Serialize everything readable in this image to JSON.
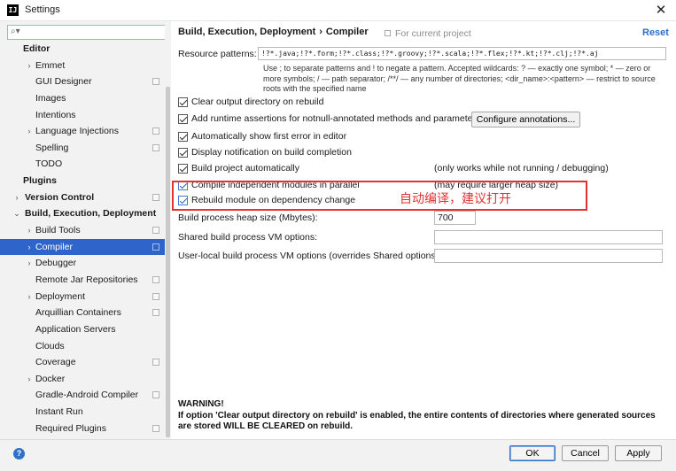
{
  "window": {
    "title": "Settings",
    "icon": "intellij-app-icon"
  },
  "search": {
    "placeholder": "",
    "value": ""
  },
  "sidebar": {
    "items": [
      {
        "label": "Editor",
        "level": 0,
        "bold": true,
        "arrow": "",
        "shared": false
      },
      {
        "label": "Emmet",
        "level": 1,
        "bold": false,
        "arrow": "›",
        "shared": false
      },
      {
        "label": "GUI Designer",
        "level": 1,
        "bold": false,
        "arrow": "",
        "shared": true
      },
      {
        "label": "Images",
        "level": 1,
        "bold": false,
        "arrow": "",
        "shared": false
      },
      {
        "label": "Intentions",
        "level": 1,
        "bold": false,
        "arrow": "",
        "shared": false
      },
      {
        "label": "Language Injections",
        "level": 1,
        "bold": false,
        "arrow": "›",
        "shared": true
      },
      {
        "label": "Spelling",
        "level": 1,
        "bold": false,
        "arrow": "",
        "shared": true
      },
      {
        "label": "TODO",
        "level": 1,
        "bold": false,
        "arrow": "",
        "shared": false
      },
      {
        "label": "Plugins",
        "level": 0,
        "bold": true,
        "arrow": "",
        "shared": false
      },
      {
        "label": "Version Control",
        "level": 0,
        "bold": true,
        "arrow": "›",
        "shared": true
      },
      {
        "label": "Build, Execution, Deployment",
        "level": 0,
        "bold": true,
        "arrow": "⌄",
        "shared": false
      },
      {
        "label": "Build Tools",
        "level": 1,
        "bold": false,
        "arrow": "›",
        "shared": true
      },
      {
        "label": "Compiler",
        "level": 1,
        "bold": false,
        "arrow": "›",
        "shared": true,
        "selected": true
      },
      {
        "label": "Debugger",
        "level": 1,
        "bold": false,
        "arrow": "›",
        "shared": false
      },
      {
        "label": "Remote Jar Repositories",
        "level": 1,
        "bold": false,
        "arrow": "",
        "shared": true
      },
      {
        "label": "Deployment",
        "level": 1,
        "bold": false,
        "arrow": "›",
        "shared": true
      },
      {
        "label": "Arquillian Containers",
        "level": 1,
        "bold": false,
        "arrow": "",
        "shared": true
      },
      {
        "label": "Application Servers",
        "level": 1,
        "bold": false,
        "arrow": "",
        "shared": false
      },
      {
        "label": "Clouds",
        "level": 1,
        "bold": false,
        "arrow": "",
        "shared": false
      },
      {
        "label": "Coverage",
        "level": 1,
        "bold": false,
        "arrow": "",
        "shared": true
      },
      {
        "label": "Docker",
        "level": 1,
        "bold": false,
        "arrow": "›",
        "shared": false
      },
      {
        "label": "Gradle-Android Compiler",
        "level": 1,
        "bold": false,
        "arrow": "",
        "shared": true
      },
      {
        "label": "Instant Run",
        "level": 1,
        "bold": false,
        "arrow": "",
        "shared": false
      },
      {
        "label": "Required Plugins",
        "level": 1,
        "bold": false,
        "arrow": "",
        "shared": true
      }
    ]
  },
  "header": {
    "breadcrumb_parent": "Build, Execution, Deployment",
    "breadcrumb_sep": "›",
    "breadcrumb_current": "Compiler",
    "for_project": "For current project",
    "reset": "Reset"
  },
  "compiler": {
    "resource_label": "Resource patterns:",
    "resource_value": "!?*.java;!?*.form;!?*.class;!?*.groovy;!?*.scala;!?*.flex;!?*.kt;!?*.clj;!?*.aj",
    "resource_hint": "Use ; to separate patterns and ! to negate a pattern. Accepted wildcards: ? — exactly one symbol; * — zero or more symbols; / — path separator; /**/ — any number of directories; <dir_name>:<pattern> — restrict to source roots with the specified name",
    "options": [
      {
        "label": "Clear output directory on rebuild",
        "checked": true,
        "note": ""
      },
      {
        "label": "Add runtime assertions for notnull-annotated methods and parameters",
        "checked": true,
        "note": ""
      },
      {
        "label": "Automatically show first error in editor",
        "checked": true,
        "note": ""
      },
      {
        "label": "Display notification on build completion",
        "checked": true,
        "note": ""
      },
      {
        "label": "Build project automatically",
        "checked": true,
        "note": "(only works while not running / debugging)"
      },
      {
        "label": "Compile independent modules in parallel",
        "checked": true,
        "note": "(may require larger heap size)"
      },
      {
        "label": "Rebuild module on dependency change",
        "checked": true,
        "note": ""
      }
    ],
    "configure_button": "Configure annotations...",
    "heap_label": "Build process heap size (Mbytes):",
    "heap_value": "700",
    "shared_vm_label": "Shared build process VM options:",
    "shared_vm_value": "",
    "user_vm_label": "User-local build process VM options (overrides Shared options):",
    "user_vm_value": "",
    "warning_title": "WARNING!",
    "warning_text": "If option 'Clear output directory on rebuild' is enabled, the entire contents of directories where generated sources are stored WILL BE CLEARED on rebuild."
  },
  "annotation": {
    "text": "自动编译，建议打开",
    "color": "#e23232"
  },
  "footer": {
    "help": "?",
    "ok": "OK",
    "cancel": "Cancel",
    "apply": "Apply"
  },
  "colors": {
    "selection": "#2f65ca",
    "link": "#2b6ecb",
    "annotation": "#e23232"
  }
}
